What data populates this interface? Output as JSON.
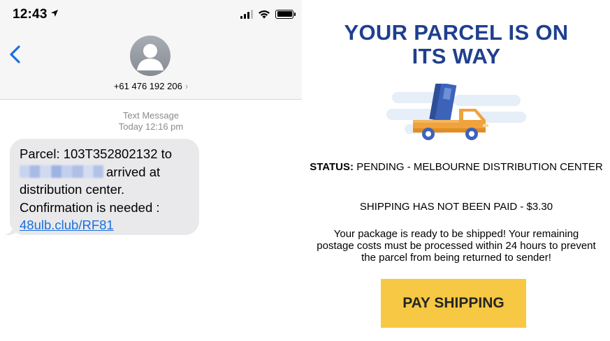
{
  "status_bar": {
    "time": "12:43",
    "location_icon": "location-arrow-icon",
    "signal_icon": "cellular-signal-icon",
    "wifi_icon": "wifi-icon",
    "battery_icon": "battery-icon"
  },
  "sms_header": {
    "back_icon": "chevron-left-icon",
    "avatar_icon": "person-avatar-icon",
    "contact_number": "+61 476 192 206",
    "contact_chevron": "›"
  },
  "sms_meta": {
    "type": "Text Message",
    "timestamp": "Today 12:16 pm"
  },
  "message": {
    "line1": "Parcel: 103T352802132 to",
    "line2_suffix": "arrived at",
    "line3": "distribution center.",
    "line4": "Confirmation is needed :",
    "link": "48ulb.club/RF81"
  },
  "phish_page": {
    "headline_line1": "YOUR PARCEL IS ON",
    "headline_line2": "ITS WAY",
    "truck_icon": "delivery-truck-icon",
    "status_label": "STATUS:",
    "status_value": "PENDING - MELBOURNE DISTRIBUTION CENTER",
    "shipping_notice": "SHIPPING HAS NOT BEEN PAID - $3.30",
    "description": "Your package is ready to be shipped! Your remaining postage costs must be processed within 24 hours to prevent the parcel from being returned to sender!",
    "button_label": "PAY SHIPPING"
  },
  "colors": {
    "headline": "#1f3f8f",
    "button": "#f6c843",
    "link": "#1a6fe0",
    "bubble": "#e9e9eb",
    "truck_body": "#f0a23c",
    "box": "#3d63b9"
  }
}
